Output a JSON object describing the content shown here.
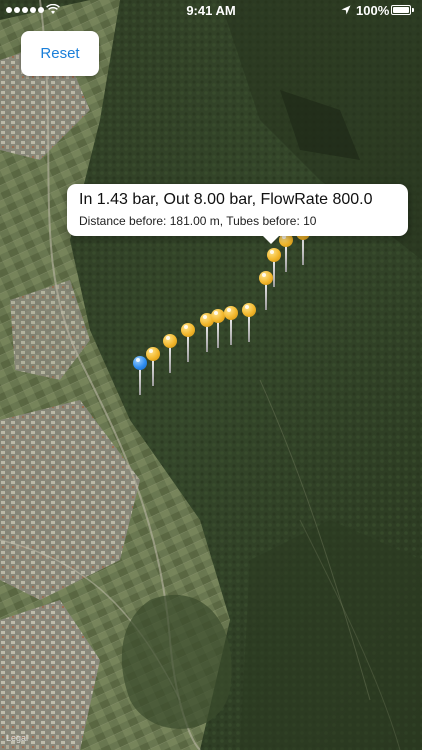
{
  "status_bar": {
    "time": "9:41 AM",
    "battery": "100%",
    "signal_dots": 5
  },
  "controls": {
    "reset_label": "Reset"
  },
  "callout": {
    "title": "In 1.43 bar, Out 8.00 bar, FlowRate 800.0",
    "subtitle": "Distance before: 181.00 m, Tubes before: 10"
  },
  "map": {
    "style": "satellite",
    "legal": "Legal"
  },
  "pins": [
    {
      "color": "blue"
    },
    {
      "color": "gold"
    },
    {
      "color": "gold"
    },
    {
      "color": "gold"
    },
    {
      "color": "gold"
    },
    {
      "color": "gold"
    },
    {
      "color": "gold"
    },
    {
      "color": "gold"
    },
    {
      "color": "gold"
    },
    {
      "color": "gold"
    },
    {
      "color": "gold"
    },
    {
      "color": "gold"
    }
  ],
  "colors": {
    "accent": "#1a7fd9",
    "pin_gold": "#f2b72c",
    "pin_blue": "#2f8ef0"
  }
}
